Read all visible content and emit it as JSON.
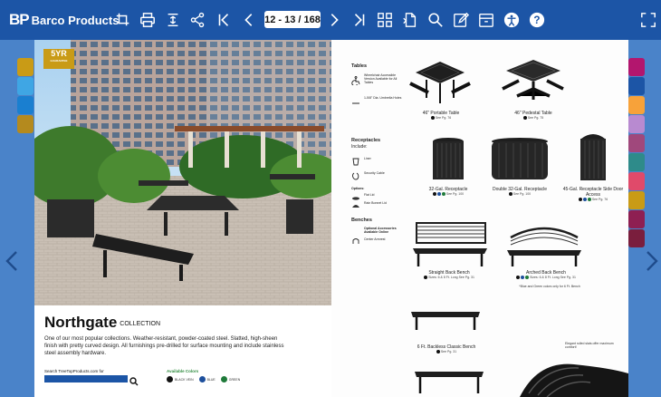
{
  "app": {
    "brand_mark": "BP",
    "brand_name": "Barco Products"
  },
  "toolbar": {
    "page_indicator": "12 - 13 / 168"
  },
  "icons": [
    "crop-icon",
    "print-icon",
    "fit-page-icon",
    "share-icon",
    "first-page-icon",
    "prev-page-icon",
    "next-page-icon",
    "last-page-icon",
    "thumbnails-icon",
    "single-page-icon",
    "search-icon",
    "edit-icon",
    "archive-icon",
    "accessibility-icon",
    "help-icon",
    "fullscreen-icon"
  ],
  "left_page": {
    "badge": {
      "big": "5YR",
      "small": "GUARANTEE"
    },
    "title": "Northgate",
    "title_suffix": "COLLECTION",
    "description": "One of our most popular collections. Weather-resistant, powder-coated steel. Slatted, high-sheen finish with pretty curved design. All furnishings pre-drilled for surface mounting and include stainless steel assembly hardware.",
    "search_label": "Search TreeTopProducts.com for",
    "colors_label": "Available Colors",
    "colors": [
      {
        "name": "BLACK VEIN",
        "hex": "#111111"
      },
      {
        "name": "BLUE",
        "hex": "#1d4f9c"
      },
      {
        "name": "GREEN",
        "hex": "#1f7a3a"
      }
    ]
  },
  "right_page": {
    "sidebar": {
      "tables": {
        "heading": "Tables",
        "item1": "Wheelchair Accessible Version Available for All Tables",
        "item2": "1-5/8\" Dia. Umbrella Holes"
      },
      "receptacles": {
        "heading": "Receptacles",
        "sub": "Include:",
        "item1": "Liner",
        "item2": "Security Cable",
        "options_label": "Options:",
        "item3": "Flat Lid",
        "item4": "Rain Bonnet Lid"
      },
      "benches": {
        "heading": "Benches",
        "item1": "Optional Accessories Available Online",
        "item2": "Center Armrest"
      }
    },
    "products": [
      {
        "name": "46\" Portable Table",
        "ref": "See Pg. 76"
      },
      {
        "name": "46\" Pedestal Table",
        "ref": "See Pg. 75"
      },
      {
        "name": "32-Gal. Receptacle",
        "ref": "See Pg. 100"
      },
      {
        "name": "Double 32-Gal. Receptacle",
        "ref": "See Pg. 100"
      },
      {
        "name": "45-Gal. Receptacle Side Door Access",
        "ref": "See Pg. 76"
      },
      {
        "name": "Straight Back Bench",
        "ref": "Sizes: 6 & 8 Ft. Long  See Pg. 31"
      },
      {
        "name": "Arched Back Bench",
        "ref": "Sizes: 6 & 8 Ft. Long  See Pg. 31"
      },
      {
        "name": "6 Ft. Backless Classic Bench",
        "ref": "See Pg. 31"
      }
    ],
    "notes": {
      "arched": "*Blue and Green colors only for 6 Ft. Bench",
      "elegant": "Elegant rolled slats offer maximum comfort!"
    }
  },
  "colors": {
    "toolbar": "#1c55a6",
    "background": "#4a83c9",
    "left_tabs": [
      "#c99b16",
      "#3fa6e4",
      "#1a7fd0",
      "#b48a1e"
    ],
    "right_tabs": [
      "#b3166e",
      "#1c55a6",
      "#f7a23a",
      "#b88ad0",
      "#a0487c",
      "#2e8b8a",
      "#e04a6a",
      "#c99b16",
      "#8e1f52",
      "#7a1e3d"
    ]
  }
}
